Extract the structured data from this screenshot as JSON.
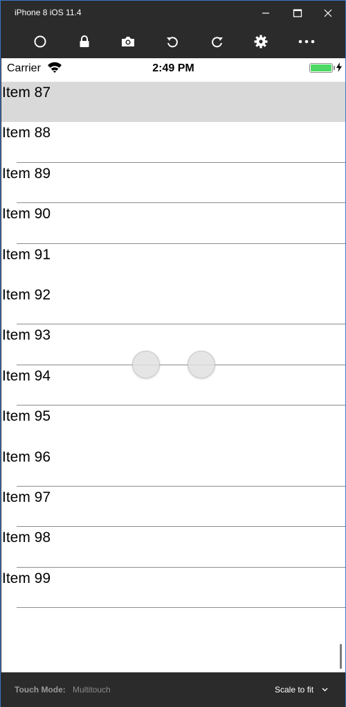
{
  "window": {
    "title": "iPhone 8 iOS 11.4",
    "border_color": "#3a78c8"
  },
  "toolbar": {
    "buttons": [
      {
        "name": "home-icon"
      },
      {
        "name": "lock-icon"
      },
      {
        "name": "camera-icon"
      },
      {
        "name": "rotate-left-icon"
      },
      {
        "name": "rotate-right-icon"
      },
      {
        "name": "gear-icon"
      },
      {
        "name": "more-icon"
      }
    ]
  },
  "status_bar": {
    "carrier": "Carrier",
    "time": "2:49 PM",
    "battery_level": 1.0,
    "battery_color": "#4cd964"
  },
  "list": {
    "selected_index": 0,
    "items": [
      "Item 87",
      "Item 88",
      "Item 89",
      "Item 90",
      "Item 91",
      "Item 92",
      "Item 93",
      "Item 94",
      "Item 95",
      "Item 96",
      "Item 97",
      "Item 98",
      "Item 99"
    ]
  },
  "bottom_bar": {
    "touch_mode_label": "Touch Mode:",
    "touch_mode_value": "Multitouch",
    "scale_label": "Scale to fit"
  }
}
